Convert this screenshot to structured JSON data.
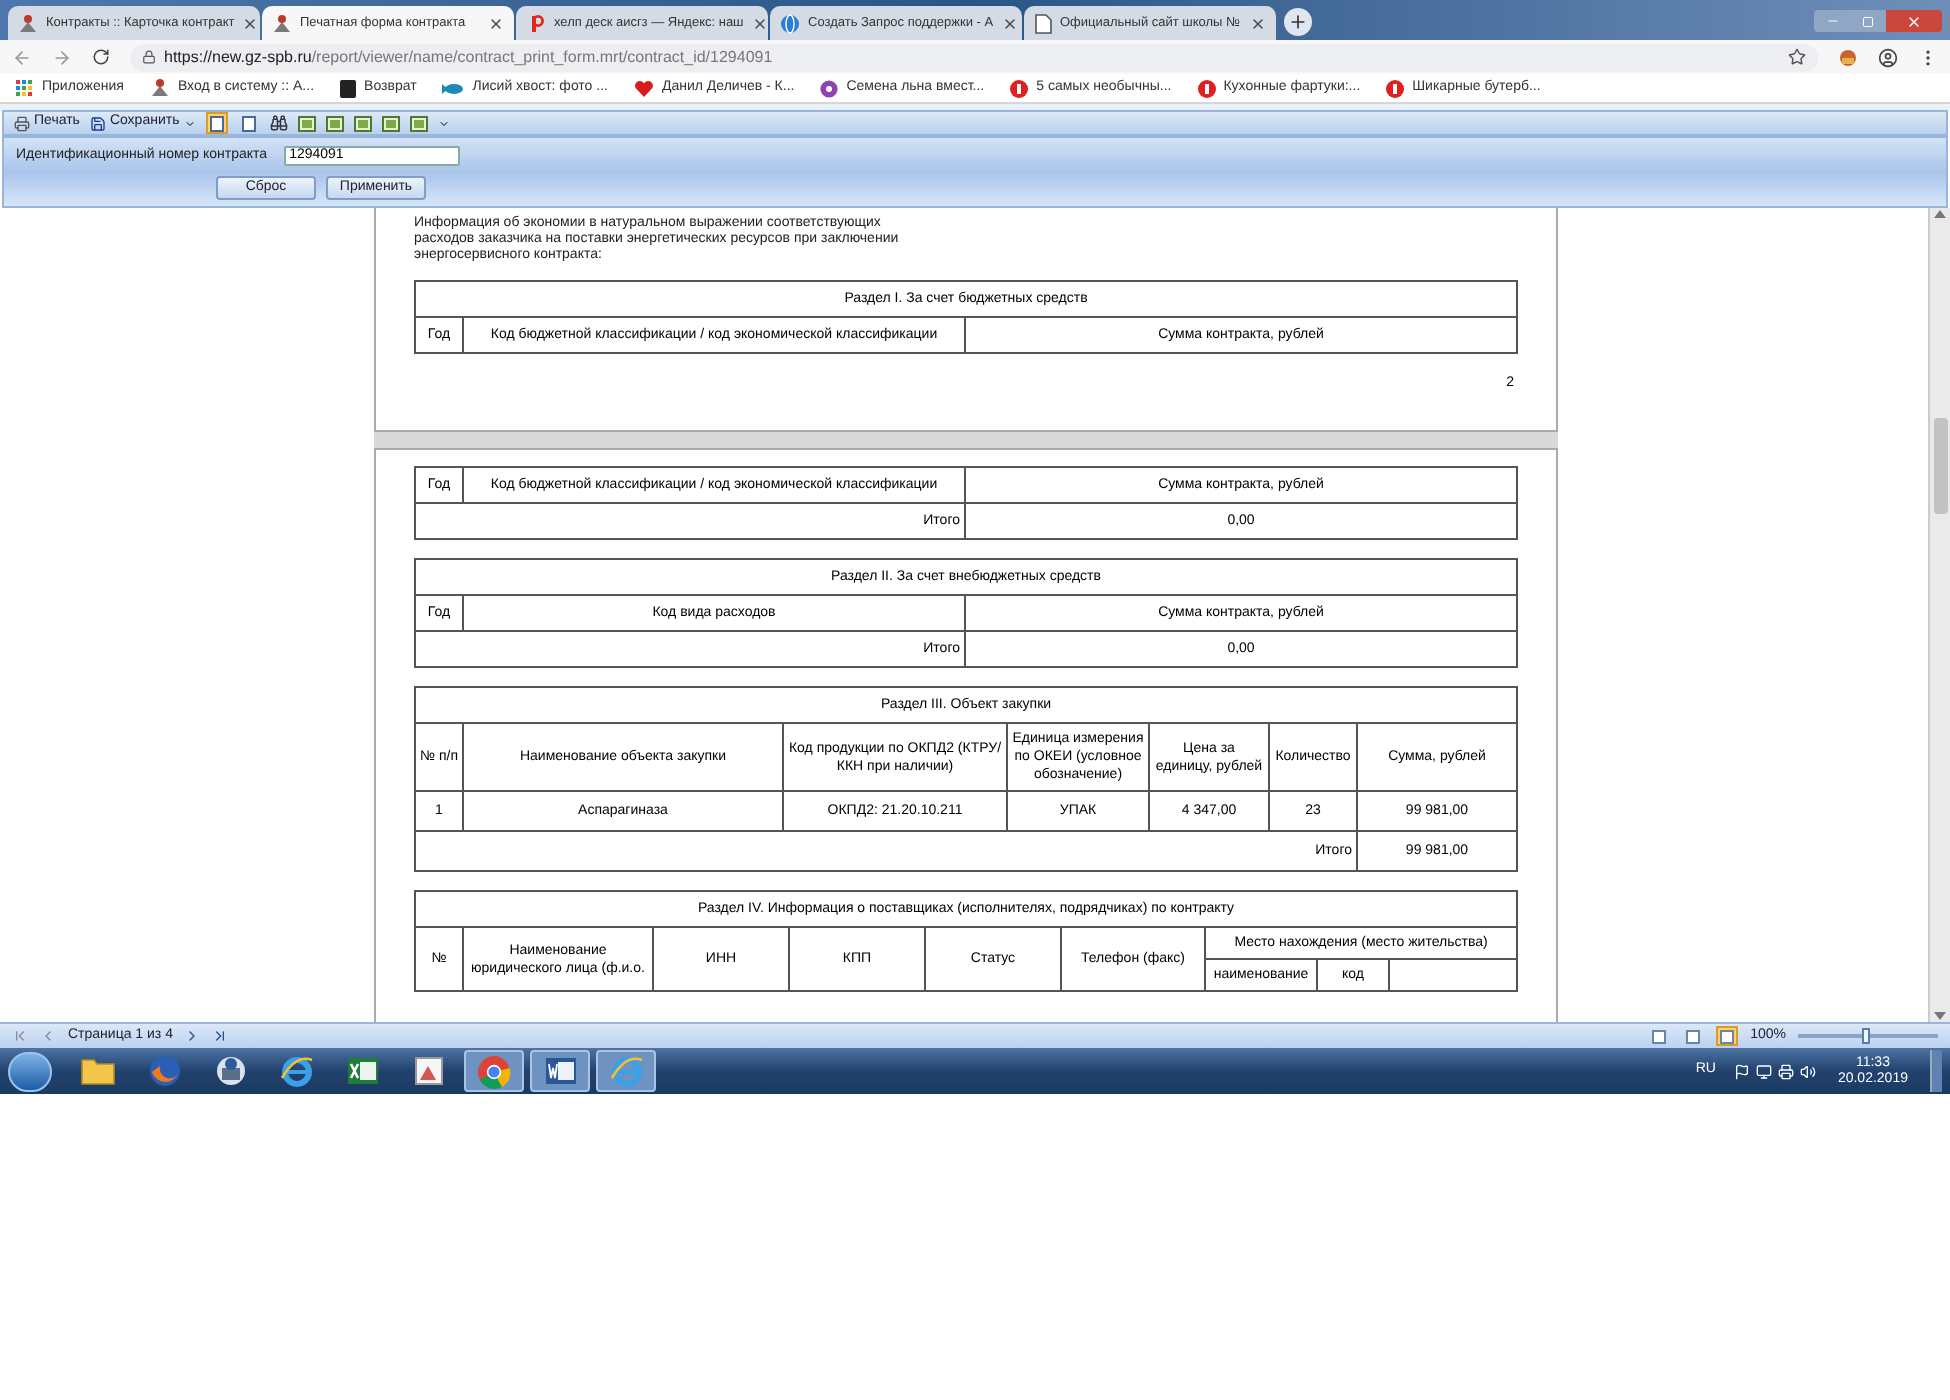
{
  "browser": {
    "tabs": [
      {
        "title": "Контракты :: Карточка контракт",
        "kind": "stimul",
        "selected": false
      },
      {
        "title": "Печатная форма контракта",
        "kind": "stimul",
        "selected": true
      },
      {
        "title": "хелп деск аисгз — Яндекс: наш",
        "kind": "yandex",
        "selected": false
      },
      {
        "title": "Создать Запрос поддержки - А",
        "kind": "globe",
        "selected": false
      },
      {
        "title": "Официальный сайт школы №",
        "kind": "page",
        "selected": false
      }
    ],
    "url_host": "https://new.gz-spb.ru",
    "url_path": "/report/viewer/name/contract_print_form.mrt/contract_id/1294091",
    "bookmarks": [
      {
        "label": "Приложения",
        "kind": "apps"
      },
      {
        "label": "Вход в систему :: А...",
        "kind": "stimul"
      },
      {
        "label": "Возврат",
        "kind": "square"
      },
      {
        "label": "Лисий хвост: фото ...",
        "kind": "swirl"
      },
      {
        "label": "Данил Деличев - К...",
        "kind": "heart"
      },
      {
        "label": "Семена льна вмест...",
        "kind": "flower"
      },
      {
        "label": "5 самых необычны...",
        "kind": "dot"
      },
      {
        "label": "Кухонные фартуки:...",
        "kind": "dot"
      },
      {
        "label": "Шикарные бутерб...",
        "kind": "dot"
      }
    ]
  },
  "toolbar": {
    "print": "Печать",
    "save": "Сохранить",
    "view_modes": [
      {
        "selected": true
      },
      {
        "selected": false
      }
    ]
  },
  "parameters": {
    "label": "Идентификационный номер контракта",
    "value": "1294091",
    "buttons": [
      "Сброс",
      "Применить"
    ]
  },
  "document": {
    "page1": {
      "intro": "Информация об экономии в натуральном выражении соответствующих расходов заказчика на поставки энергетических ресурсов при заключении энергосервисного контракта:",
      "table": {
        "title": "Раздел I. За счет бюджетных средств",
        "columns": [
          "Год",
          "Код бюджетной классификации / код экономической классификации",
          "Сумма контракта, рублей"
        ]
      },
      "page_number": "2"
    },
    "page2": {
      "section1_continued": {
        "columns": [
          "Год",
          "Код бюджетной классификации / код экономической классификации",
          "Сумма контракта, рублей"
        ],
        "total_label": "Итого",
        "total": "0,00"
      },
      "section2": {
        "title": "Раздел II. За счет внебюджетных средств",
        "columns": [
          "Год",
          "Код вида расходов",
          "Сумма контракта, рублей"
        ],
        "total_label": "Итого",
        "total": "0,00"
      },
      "section3": {
        "title": "Раздел III. Объект закупки",
        "columns": [
          "№ п/п",
          "Наименование объекта закупки",
          "Код продукции по ОКПД2 (КТРУ/ККН при наличии)",
          "Единица измерения по ОКЕИ (условное обозначение)",
          "Цена за единицу, рублей",
          "Количество",
          "Сумма, рублей"
        ],
        "rows": [
          [
            "1",
            "Аспарагиназа",
            "ОКПД2: 21.20.10.211",
            "УПАК",
            "4 347,00",
            "23",
            "99 981,00"
          ]
        ],
        "total_label": "Итого",
        "total": "99 981,00"
      },
      "section4": {
        "title": "Раздел IV. Информация о поставщиках (исполнителях, подрядчиках) по контракту",
        "columns": [
          "№",
          "Наименование юридического лица (ф.и.о.",
          "ИНН",
          "КПП",
          "Статус",
          "Телефон (факс)"
        ],
        "location_group": "Место нахождения (место жительства)",
        "location_columns": [
          "наименование",
          "код"
        ]
      }
    }
  },
  "status_bar": {
    "page": "Страница 1 из 4",
    "layouts": [
      {
        "selected": false
      },
      {
        "selected": false
      },
      {
        "selected": true
      }
    ],
    "zoom": "100%",
    "zoom_slider": {
      "level": 0.48
    }
  },
  "taskbar": {
    "apps": [
      {
        "kind": "folder",
        "open": false
      },
      {
        "kind": "firefox",
        "open": false
      },
      {
        "kind": "mail",
        "open": false
      },
      {
        "kind": "ie",
        "open": false
      },
      {
        "kind": "excel",
        "open": false
      },
      {
        "kind": "paint",
        "open": false
      },
      {
        "kind": "chrome",
        "open": true
      },
      {
        "kind": "word",
        "open": true
      },
      {
        "kind": "ie",
        "open": true
      }
    ],
    "language": "RU",
    "time": "11:33",
    "date": "20.02.2019"
  }
}
